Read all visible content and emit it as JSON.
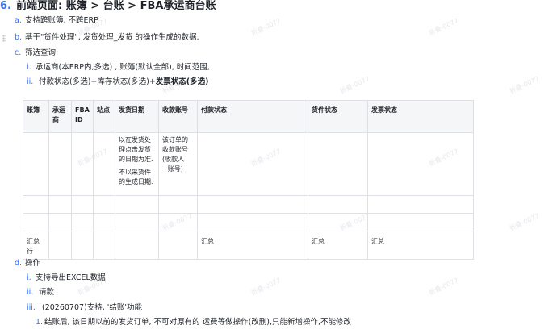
{
  "heading": {
    "number": "6.",
    "text": "前端页面: 账簿 > 台账 > FBA承运商台账"
  },
  "items": {
    "a": {
      "marker": "a.",
      "text": "支持跨账簿, 不跨ERP"
    },
    "b": {
      "marker": "b.",
      "text": "基于\"货件处理\", 发货处理_发货 的操作生成的数据."
    },
    "c": {
      "marker": "c.",
      "text": "筛选查询:"
    },
    "c_i": {
      "marker": "i.",
      "text": "承运商(本ERP内,多选) , 账簿(默认全部), 时间范围,"
    },
    "c_ii": {
      "marker": "ii.",
      "text_normal": "付款状态(多选)+库存状态(多选)+",
      "text_bold": "发票状态(多选)"
    },
    "d": {
      "marker": "d.",
      "text": "操作"
    },
    "d_i": {
      "marker": "i.",
      "text": "支持导出EXCEL数据"
    },
    "d_ii": {
      "marker": "ii.",
      "text": "请款"
    },
    "d_iii": {
      "marker": "iii.",
      "text": "(20260707)支持, '结账'功能"
    },
    "d_iii_1": {
      "marker": "1.",
      "text": "结账后, 该日期以前的发货订单, 不可对原有的 运费等做操作(改删),只能新增操作,不能修改"
    }
  },
  "table": {
    "headers": [
      "账簿",
      "承运商",
      "FBA ID",
      "站点",
      "发货日期",
      "收款账号",
      "付款状态",
      "货件状态",
      "发票状态"
    ],
    "row1": {
      "ship_date_p1": "以在发货处理点击发货的日期为准.",
      "ship_date_p2": "不以采货件的生成日期.",
      "account": "该订单的收款账号(收款人+账号)"
    },
    "summary": {
      "label": "汇总行",
      "payment": "汇总",
      "shipment": "汇总",
      "invoice": "汇总"
    }
  },
  "watermark": "折叠-0077"
}
